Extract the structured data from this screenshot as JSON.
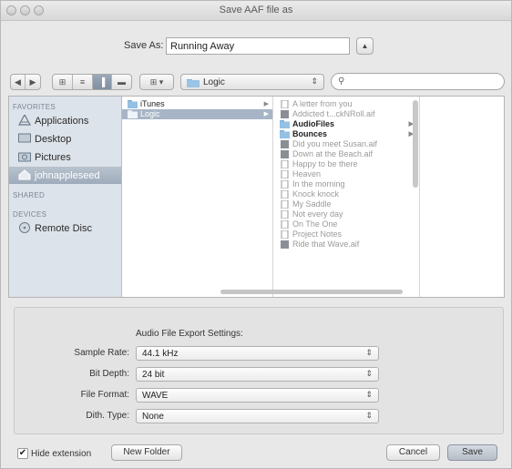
{
  "window": {
    "title": "Save AAF file as"
  },
  "save_as": {
    "label": "Save As:",
    "value": "Running Away"
  },
  "toolbar": {
    "back": "◀",
    "forward": "▶",
    "view_icon": "⊞",
    "view_list": "≡",
    "view_column": "▐",
    "view_coverflow": "▬",
    "arrange": "⊞ ▾",
    "location": "Logic",
    "search_placeholder": ""
  },
  "sidebar": {
    "favorites_header": "FAVORITES",
    "shared_header": "SHARED",
    "devices_header": "DEVICES",
    "items": [
      {
        "label": "Applications",
        "icon": "applications-icon"
      },
      {
        "label": "Desktop",
        "icon": "desktop-icon"
      },
      {
        "label": "Pictures",
        "icon": "pictures-icon"
      },
      {
        "label": "johnappleseed",
        "icon": "home-icon"
      }
    ],
    "devices": [
      {
        "label": "Remote Disc",
        "icon": "disc-icon"
      }
    ]
  },
  "column1": [
    {
      "label": "iTunes",
      "type": "folder"
    },
    {
      "label": "Logic",
      "type": "folder"
    }
  ],
  "column2": [
    {
      "label": "A letter from you",
      "type": "doc"
    },
    {
      "label": "Addicted t...ckNRoll.aif",
      "type": "audio"
    },
    {
      "label": "AudioFiles",
      "type": "folder"
    },
    {
      "label": "Bounces",
      "type": "folder"
    },
    {
      "label": "Did you meet Susan.aif",
      "type": "audio"
    },
    {
      "label": "Down at the Beach.aif",
      "type": "audio"
    },
    {
      "label": "Happy to be there",
      "type": "doc"
    },
    {
      "label": "Heaven",
      "type": "doc"
    },
    {
      "label": "In the morning",
      "type": "doc"
    },
    {
      "label": "Knock knock",
      "type": "doc"
    },
    {
      "label": "My Saddle",
      "type": "doc"
    },
    {
      "label": "Not every day",
      "type": "doc"
    },
    {
      "label": "On The One",
      "type": "doc"
    },
    {
      "label": "Project Notes",
      "type": "doc"
    },
    {
      "label": "Ride that Wave.aif",
      "type": "audio"
    }
  ],
  "settings": {
    "title": "Audio File Export Settings:",
    "sample_rate": {
      "label": "Sample Rate:",
      "value": "44.1 kHz"
    },
    "bit_depth": {
      "label": "Bit Depth:",
      "value": "24 bit"
    },
    "file_format": {
      "label": "File Format:",
      "value": "WAVE"
    },
    "dith_type": {
      "label": "Dith. Type:",
      "value": "None"
    }
  },
  "bottom": {
    "hide_extension": "Hide extension",
    "new_folder": "New Folder",
    "cancel": "Cancel",
    "save": "Save"
  }
}
